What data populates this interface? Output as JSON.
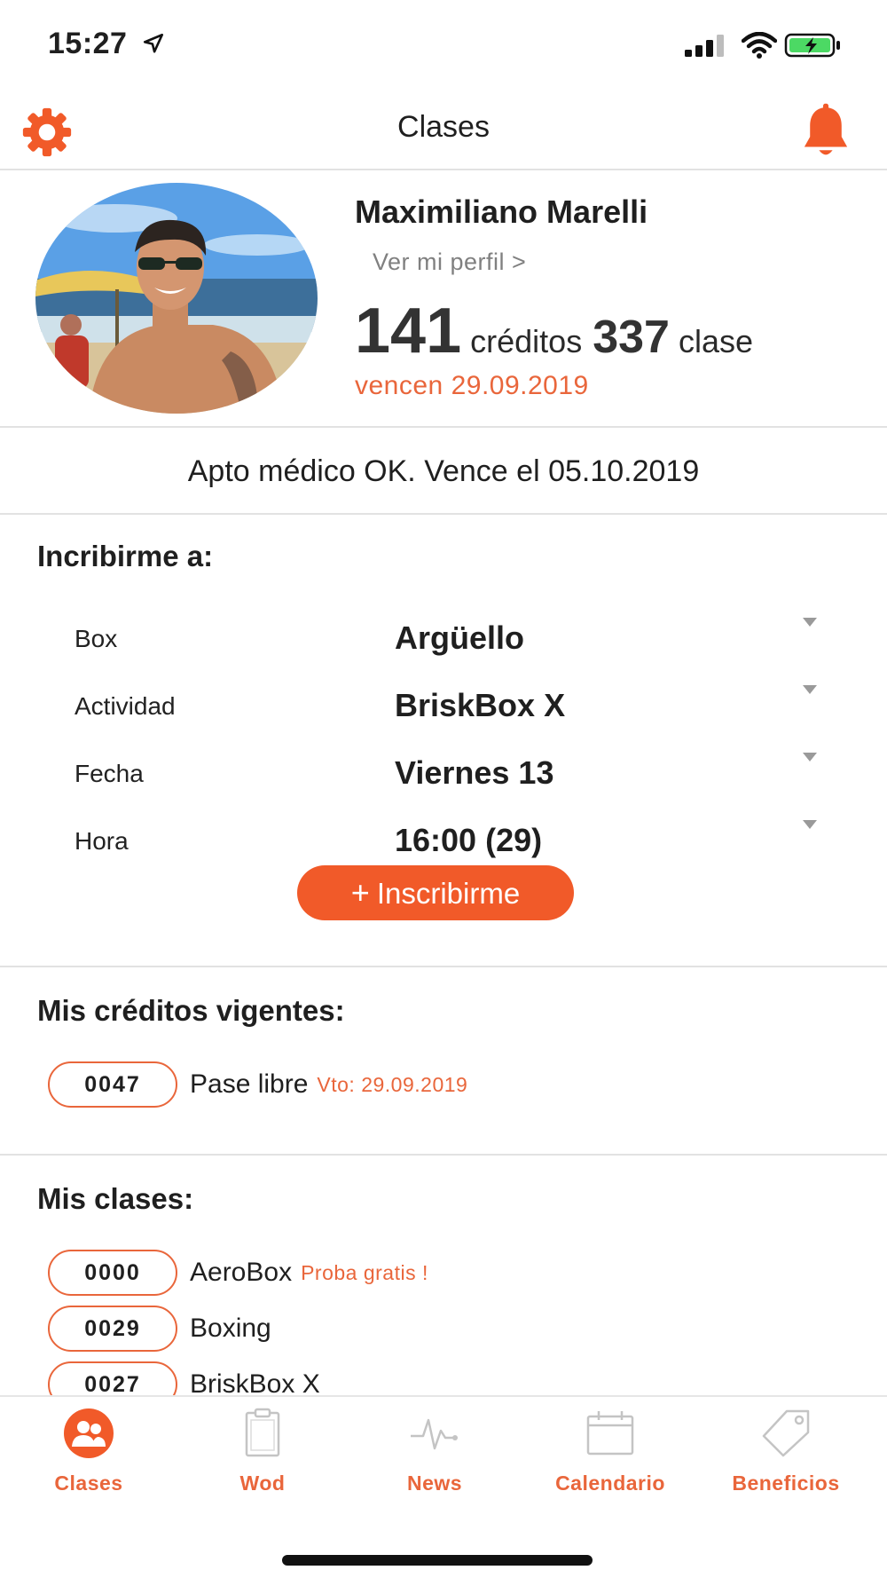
{
  "status_bar": {
    "time": "15:27"
  },
  "nav": {
    "title": "Clases",
    "left_icon": "gear-icon",
    "right_icon": "bell-icon"
  },
  "profile": {
    "name": "Maximiliano Marelli",
    "link": "Ver mi perfil >",
    "credits_value": "141",
    "credits_label": "créditos",
    "classes_value": "337",
    "classes_label": "clase",
    "expiry": "vencen 29.09.2019"
  },
  "medical": {
    "text": "Apto médico OK. Vence el 05.10.2019"
  },
  "enroll": {
    "title": "Incribirme a:",
    "fields": [
      {
        "label": "Box",
        "value": "Argüello"
      },
      {
        "label": "Actividad",
        "value": "BriskBox X"
      },
      {
        "label": "Fecha",
        "value": "Viernes 13"
      },
      {
        "label": "Hora",
        "value": "16:00 (29)"
      }
    ],
    "button_plus": "+",
    "button_label": "Inscribirme"
  },
  "credits": {
    "title": "Mis créditos vigentes:",
    "items": [
      {
        "code": "0047",
        "name": "Pase libre",
        "note": "Vto: 29.09.2019"
      }
    ]
  },
  "classes": {
    "title": "Mis clases:",
    "items": [
      {
        "code": "0000",
        "name": "AeroBox",
        "note": "Proba gratis !"
      },
      {
        "code": "0029",
        "name": "Boxing",
        "note": ""
      },
      {
        "code": "0027",
        "name": "BriskBox X",
        "note": ""
      }
    ]
  },
  "tabbar": {
    "tabs": [
      {
        "label": "Clases",
        "icon": "people-icon",
        "active": true
      },
      {
        "label": "Wod",
        "icon": "clipboard-icon",
        "active": false
      },
      {
        "label": "News",
        "icon": "pulse-icon",
        "active": false
      },
      {
        "label": "Calendario",
        "icon": "calendar-icon",
        "active": false
      },
      {
        "label": "Beneficios",
        "icon": "tag-icon",
        "active": false
      }
    ]
  },
  "colors": {
    "accent": "#f15a29",
    "accent_text": "#e9663b",
    "divider": "#e2e2e2",
    "inactive_icon": "#c4c4c4"
  }
}
